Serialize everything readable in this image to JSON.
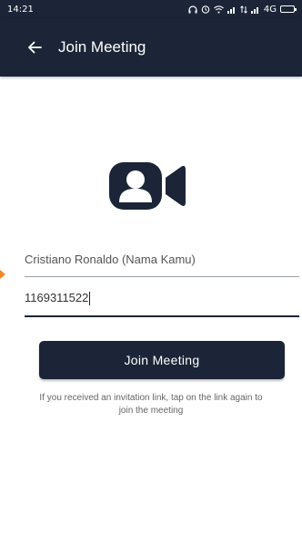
{
  "statusbar": {
    "time": "14:21",
    "network": "4G"
  },
  "appbar": {
    "title": "Join Meeting"
  },
  "form": {
    "name_value": "Cristiano Ronaldo (Nama Kamu)",
    "phone_value": "1169311522"
  },
  "actions": {
    "join_label": "Join Meeting"
  },
  "hint": {
    "text": "If you received an invitation link, tap on the link again to join the meeting"
  },
  "colors": {
    "primary": "#1b2537",
    "accent_marker": "#f08a2a"
  }
}
